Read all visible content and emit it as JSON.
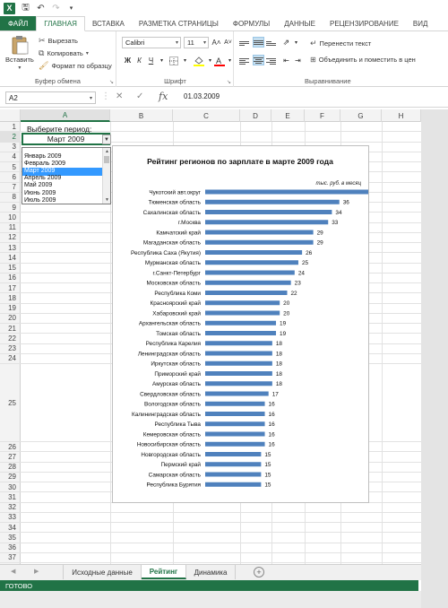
{
  "app": {
    "logo": "X",
    "qat_icons": [
      "save-icon",
      "undo-icon",
      "redo-icon",
      "customize-icon"
    ]
  },
  "tabs": [
    "ФАЙЛ",
    "ГЛАВНАЯ",
    "ВСТАВКА",
    "РАЗМЕТКА СТРАНИЦЫ",
    "ФОРМУЛЫ",
    "ДАННЫЕ",
    "РЕЦЕНЗИРОВАНИЕ",
    "ВИД"
  ],
  "ribbon": {
    "clipboard": {
      "paste": "Вставить",
      "cut": "Вырезать",
      "copy": "Копировать",
      "format_painter": "Формат по образцу",
      "label": "Буфер обмена"
    },
    "font": {
      "name": "Calibri",
      "size": "11",
      "bold": "Ж",
      "italic": "К",
      "underline": "Ч",
      "grow": "A˄",
      "shrink": "A˅",
      "label": "Шрифт"
    },
    "alignment": {
      "wrap_text": "Перенести текст",
      "merge_center": "Объединить и поместить в цен",
      "label": "Выравнивание"
    }
  },
  "formula_bar": {
    "name_box": "A2",
    "cancel": "✕",
    "enter": "✓",
    "fx": "fx",
    "value": "01.03.2009"
  },
  "grid": {
    "columns": [
      "A",
      "B",
      "C",
      "D",
      "E",
      "F",
      "G",
      "H"
    ],
    "rows": [
      "1",
      "2",
      "3",
      "4",
      "5",
      "6",
      "7",
      "8",
      "9",
      "10",
      "11",
      "12",
      "13",
      "14",
      "15",
      "16",
      "17",
      "18",
      "19",
      "20",
      "21",
      "22",
      "23",
      "24",
      "25",
      "26",
      "27",
      "28",
      "29",
      "30",
      "31",
      "32",
      "33",
      "34",
      "35",
      "36",
      "37"
    ],
    "selected_column": "A",
    "selected_row": "2",
    "a1_text": "Выберите период:",
    "a2_value": "Март 2009"
  },
  "dropdown_list": {
    "items": [
      "Январь 2009",
      "Февраль 2009",
      "Март 2009",
      "Апрель 2009",
      "Май 2009",
      "Июнь 2009",
      "Июль 2009"
    ],
    "selected": "Март 2009"
  },
  "chart_data": {
    "type": "bar",
    "orientation": "horizontal",
    "title": "Рейтинг регионов по зарплате в марте 2009 года",
    "unit_label": "тыс. руб. в месяц",
    "categories": [
      "Чукотский авт.округ",
      "Тюменская область",
      "Сахалинская область",
      "г.Москва",
      "Камчатский край",
      "Магаданская область",
      "Республика Саха (Якутия)",
      "Мурманская область",
      "г.Санкт-Петербург",
      "Московская область",
      "Республика Коми",
      "Красноярский край",
      "Хабаровский край",
      "Архангельская область",
      "Томская область",
      "Республика Карелия",
      "Ленинградская область",
      "Иркутская область",
      "Приморский край",
      "Амурская область",
      "Свердловская область",
      "Вологодская область",
      "Калининградская область",
      "Республика Тыва",
      "Кемеровская область",
      "Новосибирская область",
      "Новгородская область",
      "Пермский край",
      "Самарская область",
      "Республика Бурятия"
    ],
    "values": [
      44,
      36,
      34,
      33,
      29,
      29,
      26,
      25,
      24,
      23,
      22,
      20,
      20,
      19,
      19,
      18,
      18,
      18,
      18,
      18,
      17,
      16,
      16,
      16,
      16,
      16,
      15,
      15,
      15,
      15
    ],
    "bar_color": "#4f81bd",
    "data_labels": true,
    "axis_visible": false,
    "grid": false,
    "legend": "none"
  },
  "sheets": {
    "tabs": [
      "Исходные данные",
      "Рейтинг",
      "Динамика"
    ],
    "active": "Рейтинг",
    "add": "+"
  },
  "status": {
    "text": "ГОТОВО"
  },
  "colors": {
    "accent": "#217346",
    "selection": "#3399ff"
  }
}
